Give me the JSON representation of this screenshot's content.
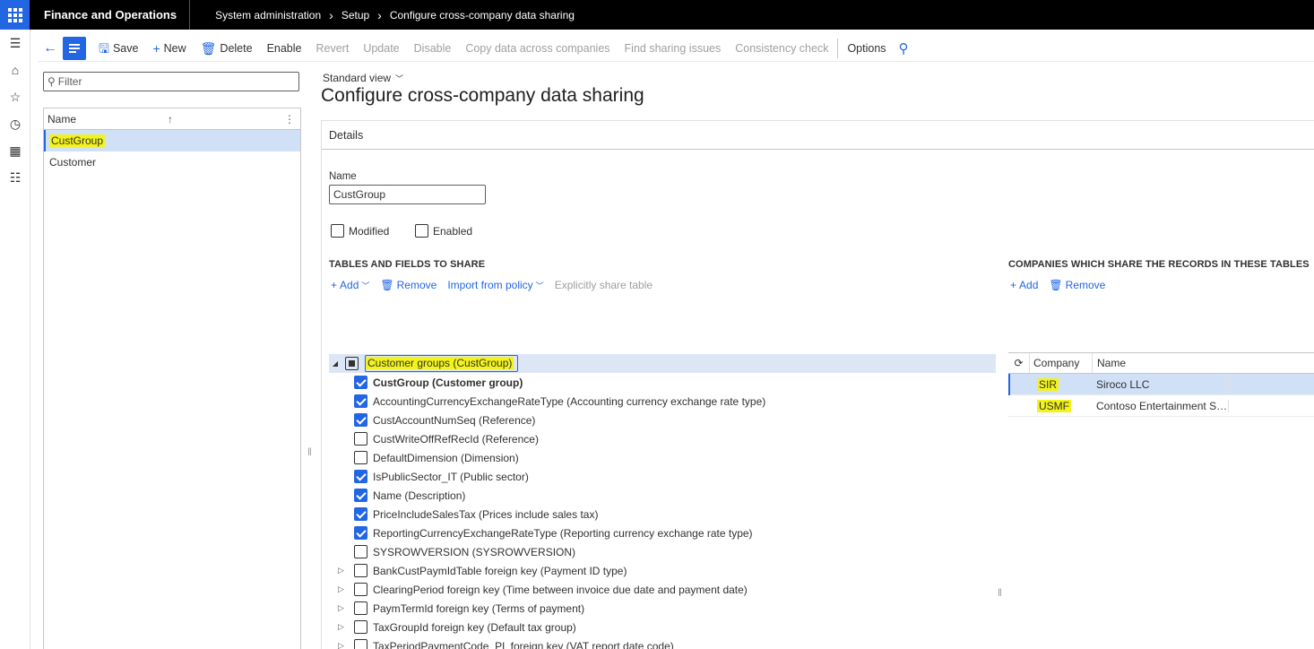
{
  "topbar": {
    "app_title": "Finance and Operations",
    "breadcrumb": [
      "System administration",
      "Setup",
      "Configure cross-company data sharing"
    ]
  },
  "actionpane": {
    "save": "Save",
    "new": "New",
    "delete": "Delete",
    "enable": "Enable",
    "revert": "Revert",
    "update": "Update",
    "disable": "Disable",
    "copy_data": "Copy data across companies",
    "find_issues": "Find sharing issues",
    "consistency": "Consistency check",
    "options": "Options"
  },
  "listpane": {
    "filter_placeholder": "Filter",
    "column_header": "Name",
    "items": [
      {
        "label": "CustGroup",
        "selected": true
      },
      {
        "label": "Customer",
        "selected": false
      }
    ]
  },
  "main": {
    "view": "Standard view",
    "title": "Configure cross-company data sharing",
    "details_header": "Details",
    "name_label": "Name",
    "name_value": "CustGroup",
    "modified_label": "Modified",
    "enabled_label": "Enabled"
  },
  "tables_section": {
    "title": "TABLES AND FIELDS TO SHARE",
    "add": "Add",
    "remove": "Remove",
    "import": "Import from policy",
    "explicit": "Explicitly share table",
    "root": "Customer groups (CustGroup)",
    "fields": [
      {
        "label": "CustGroup (Customer group)",
        "checked": true,
        "bold": true
      },
      {
        "label": "AccountingCurrencyExchangeRateType (Accounting currency exchange rate type)",
        "checked": true
      },
      {
        "label": "CustAccountNumSeq (Reference)",
        "checked": true
      },
      {
        "label": "CustWriteOffRefRecId (Reference)",
        "checked": false
      },
      {
        "label": "DefaultDimension (Dimension)",
        "checked": false
      },
      {
        "label": "IsPublicSector_IT (Public sector)",
        "checked": true
      },
      {
        "label": "Name (Description)",
        "checked": true
      },
      {
        "label": "PriceIncludeSalesTax (Prices include sales tax)",
        "checked": true
      },
      {
        "label": "ReportingCurrencyExchangeRateType (Reporting currency exchange rate type)",
        "checked": true
      },
      {
        "label": "SYSROWVERSION (SYSROWVERSION)",
        "checked": false
      }
    ],
    "foreign_keys": [
      "BankCustPaymIdTable foreign key (Payment ID type)",
      "ClearingPeriod foreign key (Time between invoice due date and payment date)",
      "PaymTermId foreign key (Terms of payment)",
      "TaxGroupId foreign key (Default tax group)",
      "TaxPeriodPaymentCode_PL foreign key (VAT report date code)"
    ]
  },
  "companies_section": {
    "title": "COMPANIES WHICH SHARE THE RECORDS IN THESE TABLES",
    "add": "Add",
    "remove": "Remove",
    "col_company": "Company",
    "col_name": "Name",
    "rows": [
      {
        "company": "SIR",
        "name": "Siroco LLC",
        "selected": true
      },
      {
        "company": "USMF",
        "name": "Contoso Entertainment Sy...",
        "selected": false
      }
    ]
  },
  "colors": {
    "accent": "#2266e3",
    "highlight": "#f3f31c",
    "selected_row": "#cfe0f7"
  }
}
